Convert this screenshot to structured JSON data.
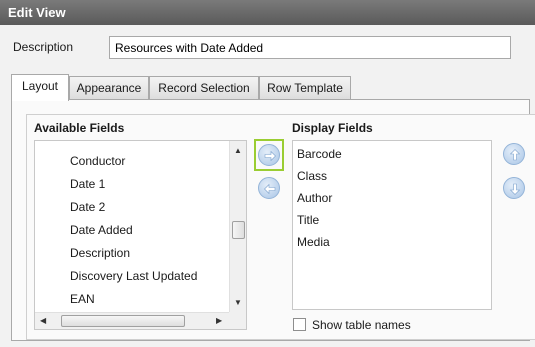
{
  "window": {
    "title": "Edit View"
  },
  "description": {
    "label": "Description",
    "value": "Resources with Date Added"
  },
  "tabs": [
    {
      "label": "Layout"
    },
    {
      "label": "Appearance"
    },
    {
      "label": "Record Selection"
    },
    {
      "label": "Row Template"
    }
  ],
  "active_tab": "Layout",
  "available": {
    "heading": "Available Fields",
    "items": [
      "Conductor",
      "Date 1",
      "Date 2",
      "Date Added",
      "Description",
      "Discovery Last Updated",
      "EAN"
    ],
    "selected": "Date Added"
  },
  "display": {
    "heading": "Display Fields",
    "items": [
      "Barcode",
      "Class",
      "Author",
      "Title",
      "Media"
    ]
  },
  "buttons": {
    "add_icon": "arrow-right-icon",
    "remove_icon": "arrow-left-icon",
    "move_up_icon": "arrow-up-icon",
    "move_down_icon": "arrow-down-icon"
  },
  "options": {
    "show_table_names_label": "Show table names",
    "show_table_names_checked": false
  },
  "colors": {
    "highlight": "#9acd32",
    "titlebar": "#666666",
    "button": "#a9c5e6"
  }
}
